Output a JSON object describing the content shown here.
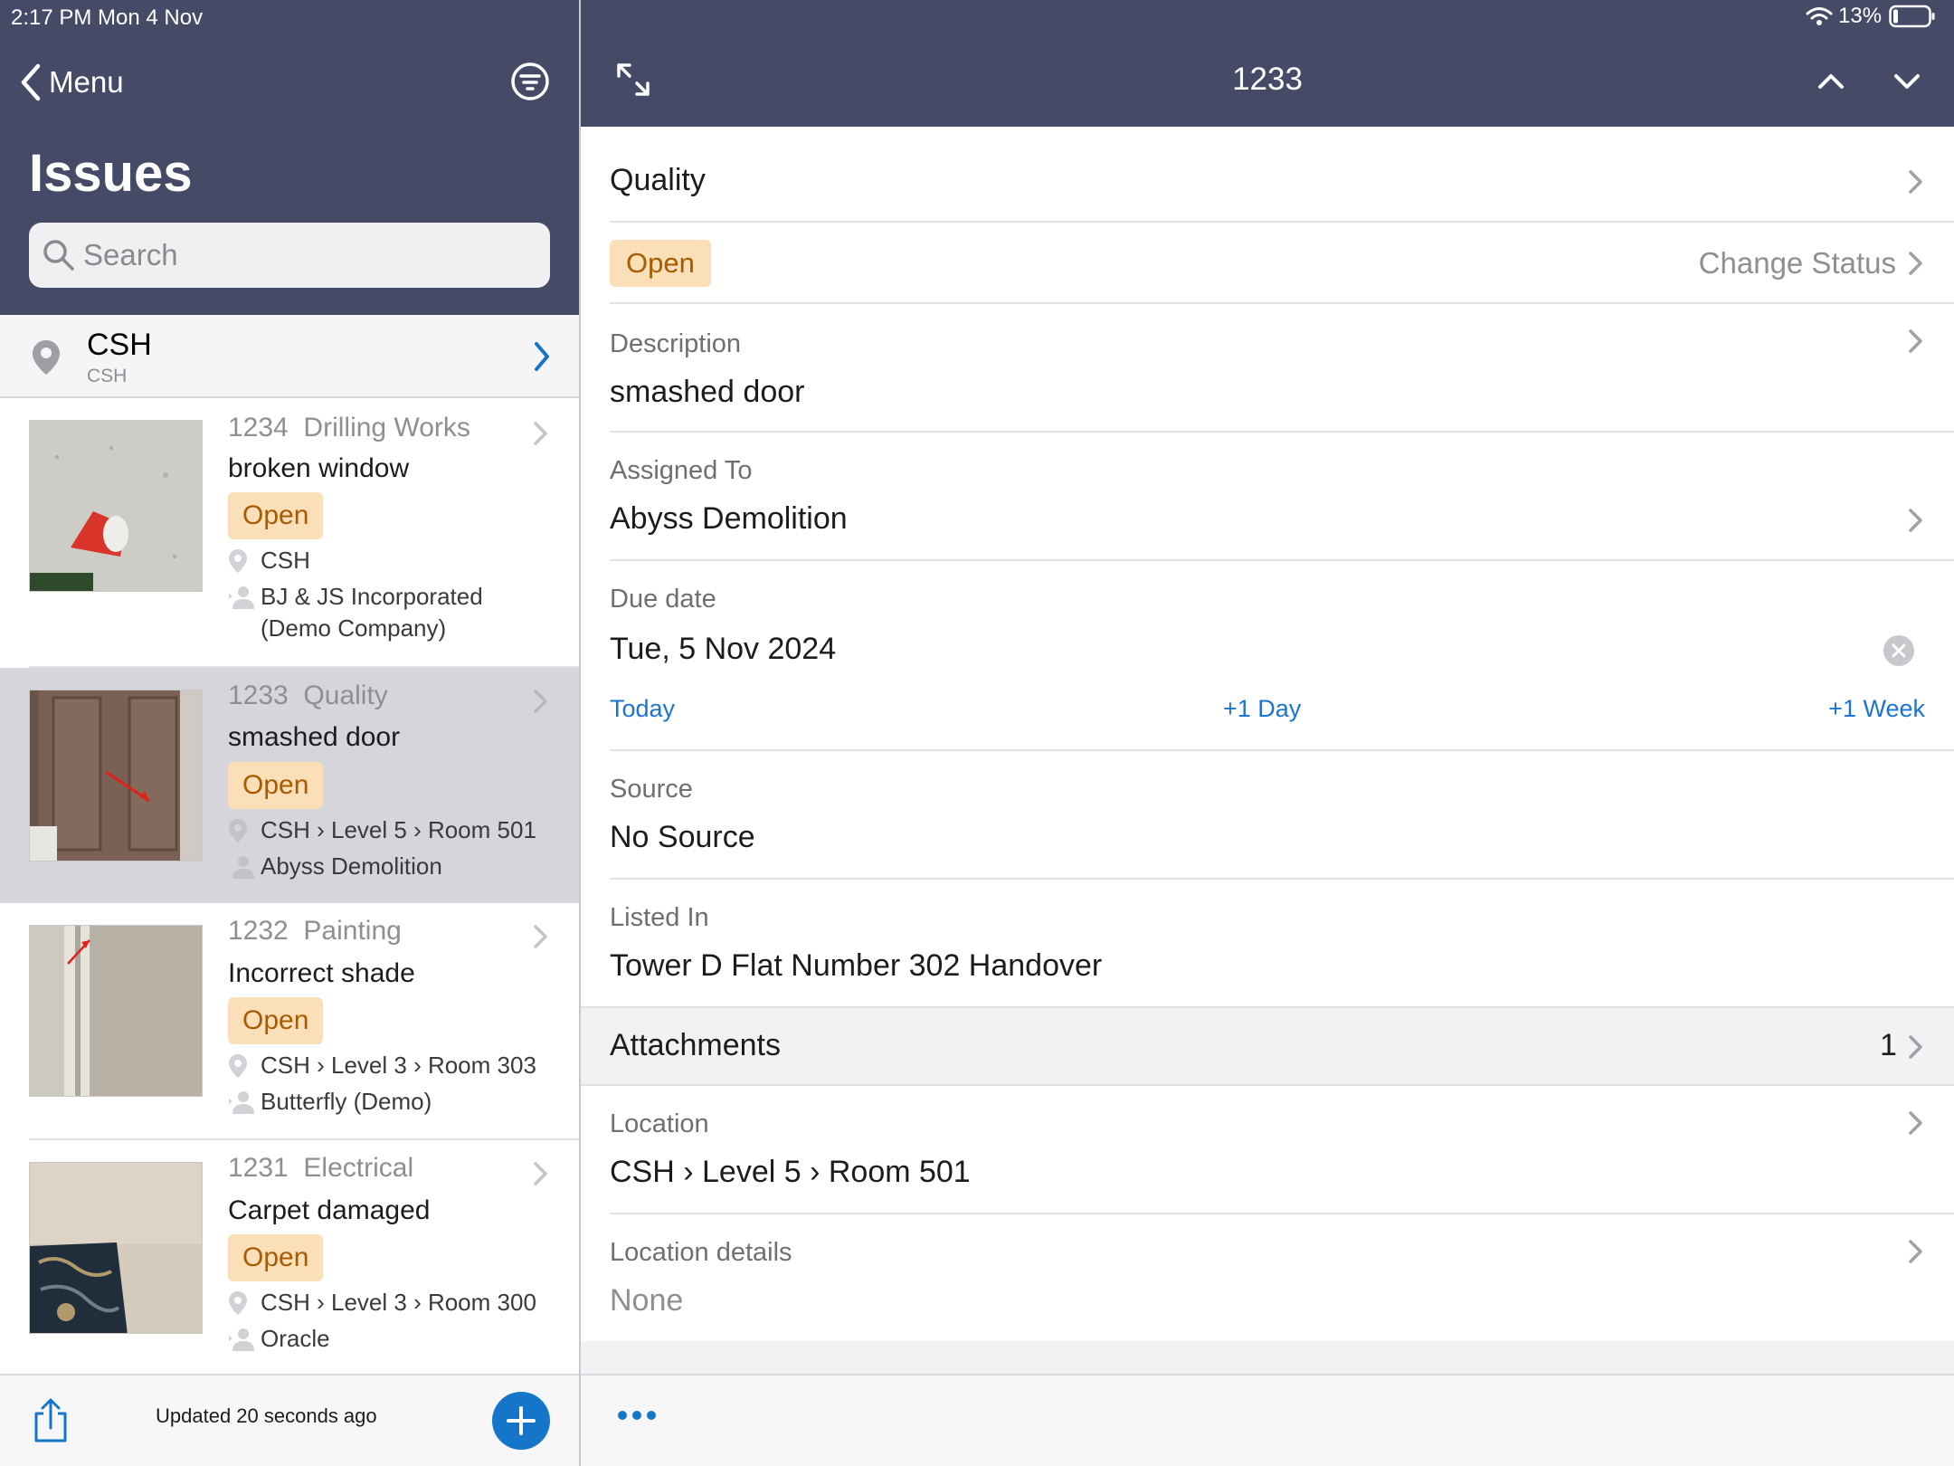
{
  "status_bar": {
    "time": "2:17 PM  Mon 4 Nov",
    "battery": "13%"
  },
  "colors": {
    "header_bg": "#454b67",
    "accent": "#1475c9",
    "badge_bg": "#fbdfb8",
    "badge_text": "#a85b00",
    "selected_row": "#d5d5db"
  },
  "sidebar": {
    "back_label": "Menu",
    "title": "Issues",
    "search_placeholder": "Search",
    "location": {
      "name": "CSH",
      "sub": "CSH"
    },
    "issues": [
      {
        "number": "1234",
        "category": "Drilling Works",
        "title": "broken window",
        "status": "Open",
        "location": "CSH",
        "assignee": "BJ & JS Incorporated (Demo Company)"
      },
      {
        "number": "1233",
        "category": "Quality",
        "title": "smashed door",
        "status": "Open",
        "location": "CSH › Level 5 › Room 501",
        "assignee": "Abyss Demolition"
      },
      {
        "number": "1232",
        "category": "Painting",
        "title": "Incorrect shade",
        "status": "Open",
        "location": "CSH › Level 3 › Room 303",
        "assignee": "Butterfly (Demo)"
      },
      {
        "number": "1231",
        "category": "Electrical",
        "title": "Carpet damaged",
        "status": "Open",
        "location": "CSH › Level 3 › Room 300",
        "assignee": "Oracle"
      }
    ],
    "footer": {
      "updated": "Updated 20 seconds ago"
    }
  },
  "detail": {
    "title": "1233",
    "category": "Quality",
    "status": "Open",
    "change_status": "Change Status",
    "description": {
      "label": "Description",
      "value": "smashed door"
    },
    "assigned": {
      "label": "Assigned To",
      "value": "Abyss Demolition"
    },
    "due": {
      "label": "Due date",
      "value": "Tue, 5 Nov 2024",
      "today": "Today",
      "plus_day": "+1 Day",
      "plus_week": "+1 Week"
    },
    "source": {
      "label": "Source",
      "value": "No Source"
    },
    "listed": {
      "label": "Listed In",
      "value": "Tower D Flat Number 302 Handover"
    },
    "attachments": {
      "label": "Attachments",
      "count": "1"
    },
    "location": {
      "label": "Location",
      "value": "CSH › Level 5 › Room 501"
    },
    "location_details": {
      "label": "Location details",
      "value": "None"
    }
  }
}
